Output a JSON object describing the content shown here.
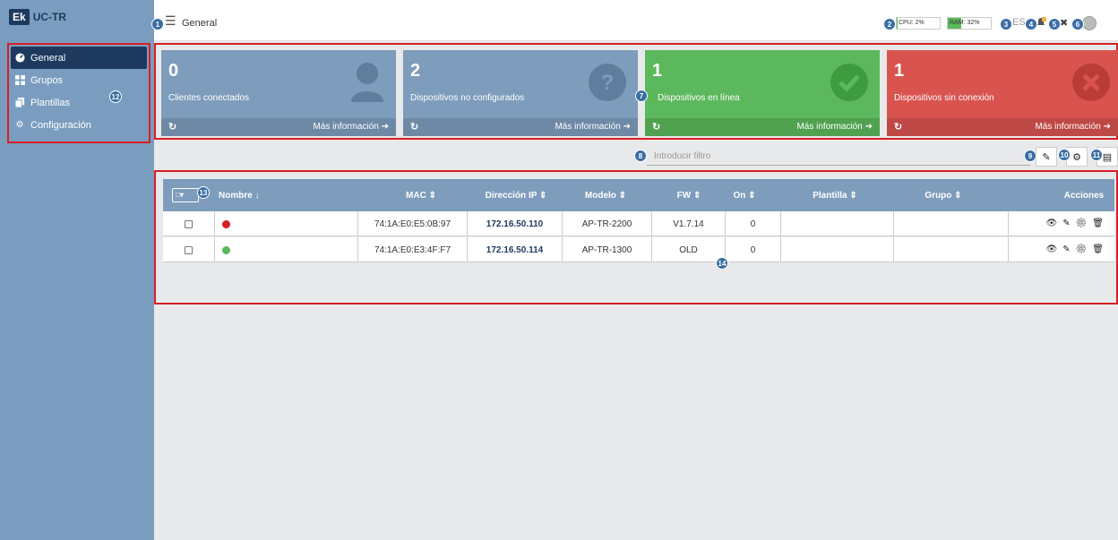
{
  "brand": {
    "logo": "Ek",
    "name": "UC-TR"
  },
  "sidebar": {
    "items": [
      {
        "label": "General",
        "icon": "dashboard-icon",
        "active": true
      },
      {
        "label": "Grupos",
        "icon": "grid-icon"
      },
      {
        "label": "Plantillas",
        "icon": "copy-icon"
      },
      {
        "label": "Configuración",
        "icon": "gear-icon"
      }
    ]
  },
  "header": {
    "title": "General",
    "cpu_label": "CPU: 2%",
    "cpu_value": 0.02,
    "ram_label": "RAM: 32%",
    "ram_value": 0.32,
    "lang": "ES"
  },
  "markers": [
    "1",
    "2",
    "3",
    "4",
    "5",
    "6",
    "7",
    "8",
    "9",
    "10",
    "11",
    "12",
    "13",
    "14"
  ],
  "cards": [
    {
      "count": "0",
      "label": "Clientes conectados",
      "more": "Más información",
      "color": "#7e9cbc",
      "icon": "user-icon"
    },
    {
      "count": "2",
      "label": "Dispositivos no configurados",
      "more": "Más información",
      "color": "#7e9cbc",
      "icon": "question-icon"
    },
    {
      "count": "1",
      "label": "Dispositivos en línea",
      "more": "Más información",
      "color": "#5cb85c",
      "icon": "check-icon"
    },
    {
      "count": "1",
      "label": "Dispositivos sin conexión",
      "more": "Más información",
      "color": "#d9534f",
      "icon": "times-icon"
    }
  ],
  "filter": {
    "placeholder": "Introducir filtro"
  },
  "table": {
    "columns": [
      "Nombre",
      "MAC",
      "Dirección IP",
      "Modelo",
      "FW",
      "On",
      "Plantilla",
      "Grupo",
      "Acciones"
    ],
    "rows": [
      {
        "status_color": "#d61f26",
        "mac": "74:1A:E0:E5:0B:97",
        "ip": "172.16.50.110",
        "model": "AP-TR-2200",
        "fw": "V1.7.14",
        "on": "0",
        "template": "",
        "group": ""
      },
      {
        "status_color": "#5cb85c",
        "mac": "74:1A:E0:E3:4F:F7",
        "ip": "172.16.50.114",
        "model": "AP-TR-1300",
        "fw": "OLD",
        "on": "0",
        "template": "",
        "group": ""
      }
    ]
  }
}
